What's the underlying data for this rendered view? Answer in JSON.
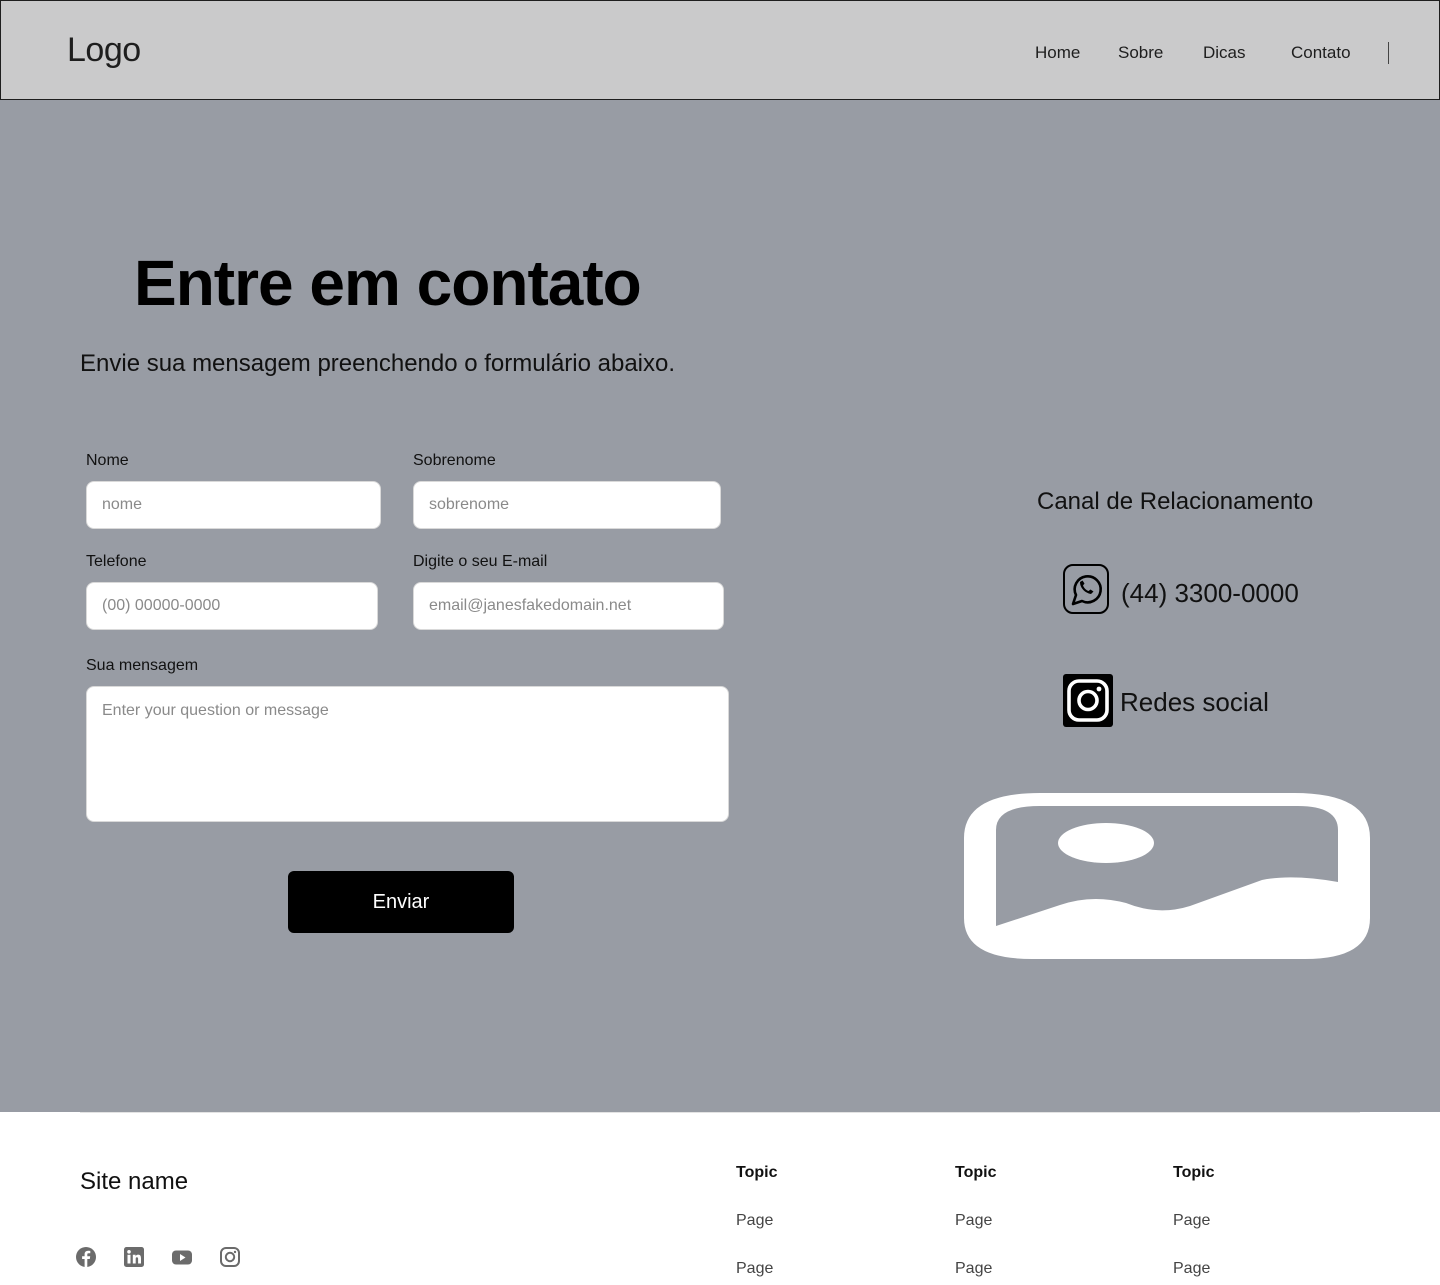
{
  "header": {
    "logo": "Logo",
    "nav": [
      "Home",
      "Sobre",
      "Dicas",
      "Contato"
    ]
  },
  "hero": {
    "title": "Entre em contato",
    "subtitle": "Envie sua mensagem preenchendo o formulário abaixo."
  },
  "form": {
    "nome_label": "Nome",
    "nome_placeholder": "nome",
    "sobrenome_label": "Sobrenome",
    "sobrenome_placeholder": "sobrenome",
    "telefone_label": "Telefone",
    "telefone_placeholder": "(00) 00000-0000",
    "email_label": "Digite o seu E-mail",
    "email_placeholder": "email@janesfakedomain.net",
    "mensagem_label": "Sua mensagem",
    "mensagem_placeholder": "Enter your question or message",
    "submit_label": "Enviar"
  },
  "contact": {
    "heading": "Canal de Relacionamento",
    "phone": "(44) 3300-0000",
    "phone_icon": "whatsapp-icon",
    "social_label": "Redes social",
    "social_icon": "instagram-icon",
    "image_icon": "image-placeholder-icon"
  },
  "footer": {
    "site_name": "Site name",
    "social_icons": [
      "facebook-icon",
      "linkedin-icon",
      "youtube-icon",
      "instagram-icon"
    ],
    "columns": [
      {
        "topic": "Topic",
        "pages": [
          "Page",
          "Page"
        ]
      },
      {
        "topic": "Topic",
        "pages": [
          "Page",
          "Page"
        ]
      },
      {
        "topic": "Topic",
        "pages": [
          "Page",
          "Page"
        ]
      }
    ]
  },
  "colors": {
    "header_bg": "#cacacb",
    "hero_bg": "#989ca4",
    "button_bg": "#000000",
    "footer_bg": "#ffffff"
  }
}
